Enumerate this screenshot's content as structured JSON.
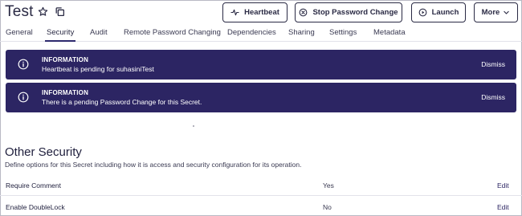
{
  "header": {
    "title": "Test",
    "buttons": {
      "heartbeat": "Heartbeat",
      "stop_password_change": "Stop Password Change",
      "launch": "Launch",
      "more": "More"
    }
  },
  "tabs": [
    {
      "label": "General",
      "active": false
    },
    {
      "label": "Security",
      "active": true
    },
    {
      "label": "Audit",
      "active": false
    },
    {
      "label": "Remote Password Changing",
      "active": false
    },
    {
      "label": "Dependencies",
      "active": false
    },
    {
      "label": "Sharing",
      "active": false
    },
    {
      "label": "Settings",
      "active": false
    },
    {
      "label": "Metadata",
      "active": false
    }
  ],
  "banners": [
    {
      "title": "INFORMATION",
      "message": "Heartbeat is pending for suhasiniTest",
      "dismiss": "Dismiss"
    },
    {
      "title": "INFORMATION",
      "message": "There is a pending Password Change for this Secret.",
      "dismiss": "Dismiss"
    }
  ],
  "other_security": {
    "title": "Other Security",
    "description": "Define options for this Secret including how it is access and security configuration for its operation.",
    "rows": [
      {
        "label": "Require Comment",
        "value": "Yes",
        "action": "Edit"
      },
      {
        "label": "Enable DoubleLock",
        "value": "No",
        "action": "Edit"
      }
    ]
  },
  "colors": {
    "banner_bg": "#2c2563",
    "text_dark": "#1f1f3d",
    "active_tab_underline": "#2d2a6e"
  }
}
